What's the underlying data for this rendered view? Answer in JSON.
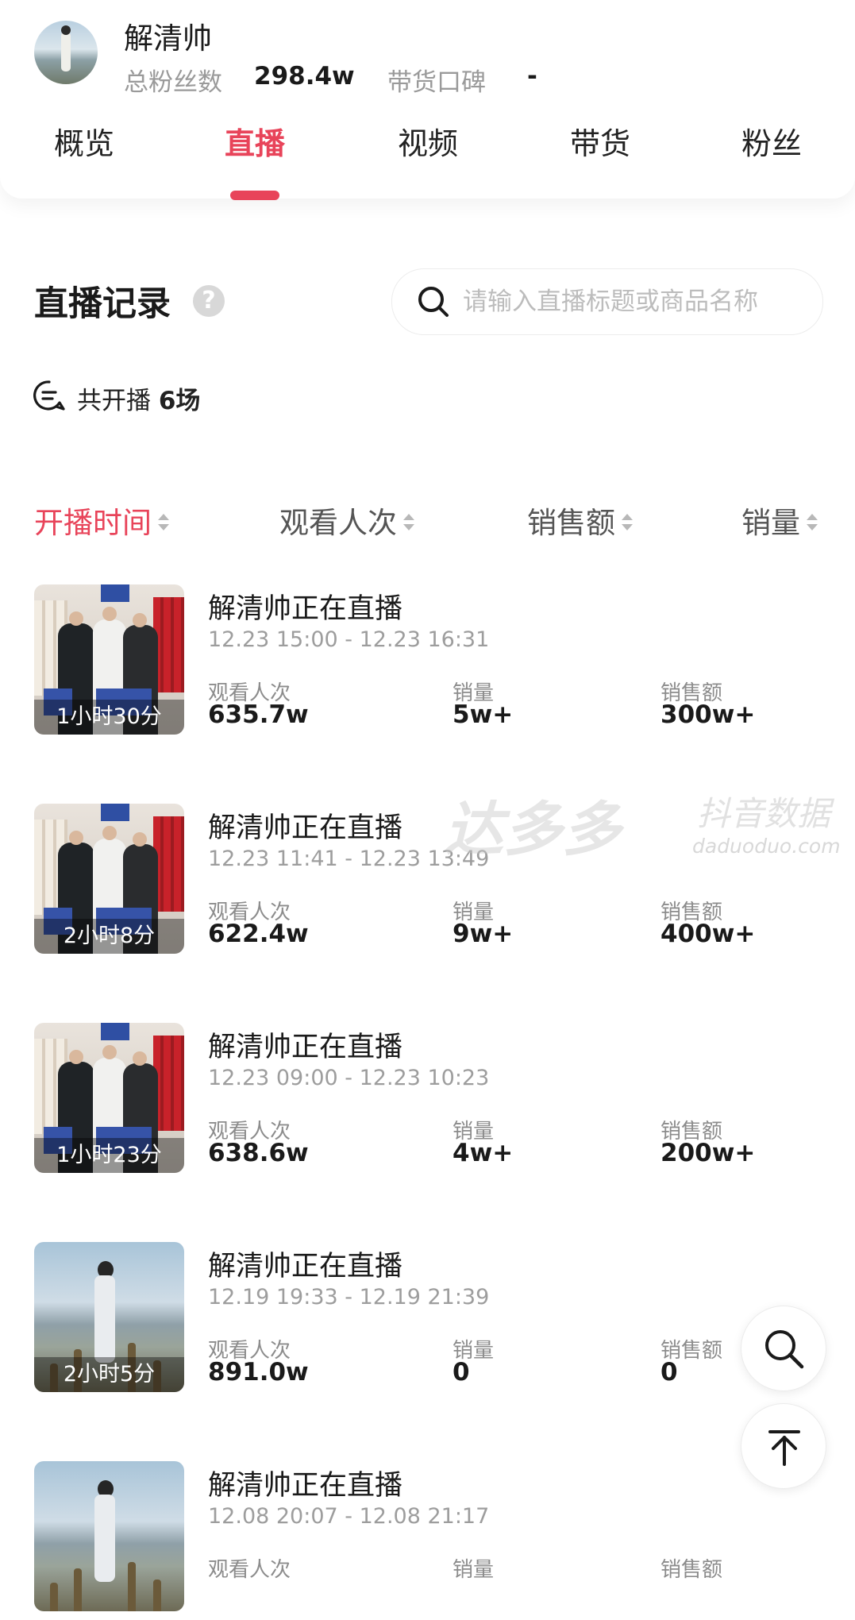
{
  "profile": {
    "name": "解清帅",
    "fans_label": "总粉丝数",
    "fans_value": "298.4w",
    "reputation_label": "带货口碑",
    "reputation_value": "-"
  },
  "tabs": [
    {
      "label": "概览",
      "active": false
    },
    {
      "label": "直播",
      "active": true
    },
    {
      "label": "视频",
      "active": false
    },
    {
      "label": "带货",
      "active": false
    },
    {
      "label": "粉丝",
      "active": false
    }
  ],
  "section": {
    "title": "直播记录",
    "help": "?",
    "search_placeholder": "请输入直播标题或商品名称",
    "total_prefix": "共开播",
    "total_count": "6场"
  },
  "sort_options": [
    {
      "label": "开播时间",
      "active": true
    },
    {
      "label": "观看人次",
      "active": false
    },
    {
      "label": "销售额",
      "active": false
    },
    {
      "label": "销量",
      "active": false
    }
  ],
  "metric_labels": {
    "views": "观看人次",
    "sales_count": "销量",
    "sales_amount": "销售额"
  },
  "records": [
    {
      "title": "解清帅正在直播",
      "time": "12.23 15:00 - 12.23 16:31",
      "duration": "1小时30分",
      "views": "635.7w",
      "sales_count": "5w+",
      "sales_amount": "300w+",
      "thumb": "store"
    },
    {
      "title": "解清帅正在直播",
      "time": "12.23 11:41 - 12.23 13:49",
      "duration": "2小时8分",
      "views": "622.4w",
      "sales_count": "9w+",
      "sales_amount": "400w+",
      "thumb": "store"
    },
    {
      "title": "解清帅正在直播",
      "time": "12.23 09:00 - 12.23 10:23",
      "duration": "1小时23分",
      "views": "638.6w",
      "sales_count": "4w+",
      "sales_amount": "200w+",
      "thumb": "store"
    },
    {
      "title": "解清帅正在直播",
      "time": "12.19 19:33 - 12.19 21:39",
      "duration": "2小时5分",
      "views": "891.0w",
      "sales_count": "0",
      "sales_amount": "0",
      "thumb": "lake"
    },
    {
      "title": "解清帅正在直播",
      "time": "12.08 20:07 - 12.08 21:17",
      "duration": "",
      "views": "",
      "sales_count": "",
      "sales_amount": "",
      "thumb": "lake"
    }
  ],
  "watermark": {
    "brand": "达多多",
    "subtitle": "抖音数据",
    "url": "daduoduo.com"
  },
  "colors": {
    "accent": "#e8445a",
    "muted": "#9d9d9d"
  }
}
